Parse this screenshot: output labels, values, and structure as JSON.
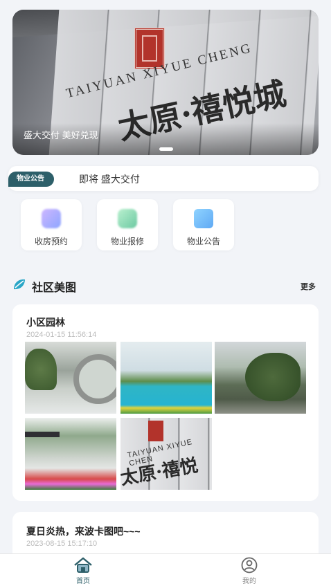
{
  "banner": {
    "caption": "盛大交付 美好兑现",
    "sign_en": "TAIYUAN XIYUE CHENG",
    "sign_cn": "太原·禧悦城"
  },
  "notice": {
    "tag": "物业公告",
    "text": "即将 盛大交付"
  },
  "quick_entries": [
    {
      "label": "收房预约",
      "icon": "calendar-icon"
    },
    {
      "label": "物业报修",
      "icon": "repair-icon"
    },
    {
      "label": "物业公告",
      "icon": "announcement-icon"
    }
  ],
  "section": {
    "title": "社区美图",
    "more": "更多"
  },
  "posts": [
    {
      "title": "小区园林",
      "time": "2024-01-15 11:56:14"
    },
    {
      "title": "夏日炎热，来波卡图吧~~~",
      "time": "2023-08-15 15:17:10"
    }
  ],
  "photo_sign": {
    "en": "TAIYUAN XIYUE CHEN",
    "cn": "太原·禧悦城"
  },
  "tabbar": {
    "home": "首页",
    "mine": "我的"
  },
  "colors": {
    "accent": "#2d5f69",
    "background": "#f2f4f8"
  }
}
